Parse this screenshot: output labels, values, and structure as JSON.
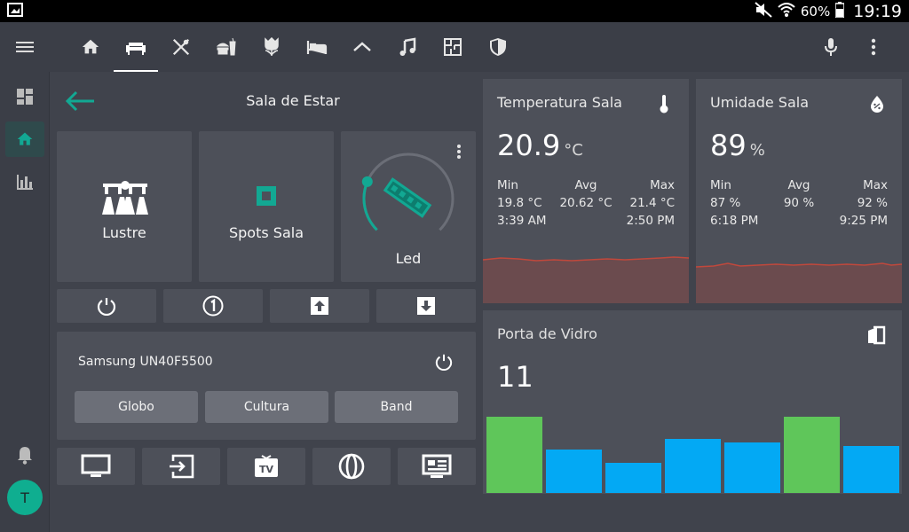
{
  "statusbar": {
    "battery": "60%",
    "time": "19:19",
    "icons": [
      "screenshot-icon",
      "mute-icon",
      "wifi-icon",
      "battery-icon"
    ]
  },
  "header": {
    "tabs": [
      {
        "name": "tab-home",
        "icon": "home-icon",
        "active": false
      },
      {
        "name": "tab-living-room",
        "icon": "sofa-icon",
        "active": true
      },
      {
        "name": "tab-kitchen",
        "icon": "cutlery-icon",
        "active": false
      },
      {
        "name": "tab-dining",
        "icon": "food-icon",
        "active": false
      },
      {
        "name": "tab-garden",
        "icon": "flower-icon",
        "active": false
      },
      {
        "name": "tab-bedroom",
        "icon": "bed-icon",
        "active": false
      },
      {
        "name": "tab-roof",
        "icon": "roof-icon",
        "active": false
      },
      {
        "name": "tab-music",
        "icon": "music-icon",
        "active": false
      },
      {
        "name": "tab-floorplan",
        "icon": "floorplan-icon",
        "active": false
      },
      {
        "name": "tab-security",
        "icon": "shield-icon",
        "active": false
      }
    ]
  },
  "sidebar": {
    "items": [
      {
        "name": "sidebar-item-overview",
        "icon": "dashboard-icon",
        "active": false
      },
      {
        "name": "sidebar-item-home",
        "icon": "home-icon",
        "active": true
      },
      {
        "name": "sidebar-item-history",
        "icon": "bar-chart-icon",
        "active": false
      }
    ],
    "avatar_initial": "T"
  },
  "room": {
    "title": "Sala de Estar",
    "lights": [
      {
        "label": "Lustre",
        "icon": "chandelier-icon"
      },
      {
        "label": "Spots Sala",
        "icon": "spot-icon"
      },
      {
        "label": "Led",
        "icon": "led-strip-icon",
        "brightness_fraction": 0.25
      }
    ],
    "controls": [
      "power-icon",
      "number-one-icon",
      "arrow-up-icon",
      "arrow-down-icon"
    ],
    "tv": {
      "name": "Samsung UN40F5500",
      "channels": [
        "Globo",
        "Cultura",
        "Band"
      ],
      "controls": [
        "monitor-icon",
        "input-icon",
        "tv-icon",
        "globe-icon",
        "guide-icon"
      ]
    }
  },
  "sensors": {
    "temperature": {
      "title": "Temperatura Sala",
      "value": "20.9",
      "unit": "°C",
      "min_label": "Min",
      "avg_label": "Avg",
      "max_label": "Max",
      "min": "19.8 °C",
      "avg": "20.62 °C",
      "max": "21.4 °C",
      "min_time": "3:39 AM",
      "max_time": "2:50 PM"
    },
    "humidity": {
      "title": "Umidade Sala",
      "value": "89",
      "unit": "%",
      "min_label": "Min",
      "avg_label": "Avg",
      "max_label": "Max",
      "min": "87 %",
      "avg": "90 %",
      "max": "92 %",
      "min_time": "6:18 PM",
      "max_time": "9:25 PM"
    },
    "door": {
      "title": "Porta de Vidro",
      "value": "11",
      "bars": [
        {
          "value": 1.0,
          "color": "#5fc65a"
        },
        {
          "value": 0.57,
          "color": "#03a9f4"
        },
        {
          "value": 0.39,
          "color": "#03a9f4"
        },
        {
          "value": 0.71,
          "color": "#03a9f4"
        },
        {
          "value": 0.66,
          "color": "#03a9f4"
        },
        {
          "value": 1.0,
          "color": "#5fc65a"
        },
        {
          "value": 0.62,
          "color": "#03a9f4"
        }
      ]
    }
  },
  "colors": {
    "accent": "#12a893",
    "graph_line": "#c0483c",
    "graph_fill": "#6b4b4e",
    "bar_on": "#5fc65a",
    "bar_off": "#03a9f4"
  }
}
